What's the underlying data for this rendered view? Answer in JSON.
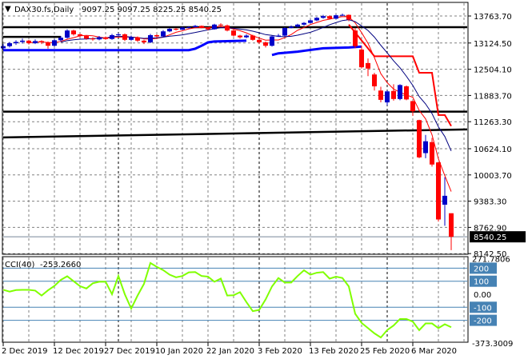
{
  "colors": {
    "bull": "#0000c8",
    "bear": "#ff0000",
    "cci": "#80ff00",
    "level": "#4682b4",
    "grid": "#808080",
    "support": "#0000ff",
    "ma_fast": "#ff0000",
    "ma_slow": "#000080"
  },
  "chart_data": [
    {
      "type": "candlestick",
      "title": "DAX30.fs,Daily",
      "ohlc_text": "9097.25 9097.25 8225.25 8540.25",
      "ylim": [
        8142.5,
        13763.7
      ],
      "y_ticks": [
        "13763.70",
        "13124.50",
        "12504.10",
        "11883.70",
        "11263.30",
        "10624.10",
        "10003.70",
        "9383.30",
        "8762.90",
        "8142.50"
      ],
      "y_tick_values": [
        13763.7,
        13124.5,
        12504.1,
        11883.7,
        11263.3,
        10624.1,
        10003.7,
        9383.3,
        8762.9,
        8142.5
      ],
      "current_price": 8540.25,
      "current_price_label": "8540.25",
      "x_labels": [
        {
          "bar": 0,
          "label": "2 Dec 2019"
        },
        {
          "bar": 8,
          "label": "12 Dec 2019"
        },
        {
          "bar": 16,
          "label": "27 Dec 2019"
        },
        {
          "bar": 24,
          "label": "10 Jan 2020"
        },
        {
          "bar": 32,
          "label": "22 Jan 2020"
        },
        {
          "bar": 40,
          "label": "3 Feb 2020"
        },
        {
          "bar": 48,
          "label": "13 Feb 2020"
        },
        {
          "bar": 56,
          "label": "25 Feb 2020"
        },
        {
          "bar": 64,
          "label": "6 Mar 2020"
        }
      ],
      "period_separators": [
        18,
        40,
        60
      ],
      "ohlc": [
        [
          13000,
          13100,
          12960,
          13050
        ],
        [
          13050,
          13150,
          13020,
          13120
        ],
        [
          13120,
          13190,
          13080,
          13150
        ],
        [
          13150,
          13230,
          13110,
          13180
        ],
        [
          13180,
          13200,
          13090,
          13120
        ],
        [
          13120,
          13210,
          13100,
          13170
        ],
        [
          13170,
          13190,
          13100,
          13140
        ],
        [
          13140,
          13160,
          12990,
          13060
        ],
        [
          13060,
          13220,
          13040,
          13190
        ],
        [
          13190,
          13290,
          13160,
          13250
        ],
        [
          13250,
          13450,
          13230,
          13420
        ],
        [
          13420,
          13440,
          13300,
          13330
        ],
        [
          13330,
          13350,
          13260,
          13290
        ],
        [
          13290,
          13310,
          13200,
          13230
        ],
        [
          13230,
          13260,
          13180,
          13210
        ],
        [
          13210,
          13290,
          13190,
          13260
        ],
        [
          13260,
          13280,
          13200,
          13220
        ],
        [
          13220,
          13340,
          13200,
          13310
        ],
        [
          13310,
          13360,
          13300,
          13330
        ],
        [
          13330,
          13350,
          13170,
          13200
        ],
        [
          13200,
          13300,
          13180,
          13260
        ],
        [
          13260,
          13280,
          13150,
          13180
        ],
        [
          13180,
          13200,
          13100,
          13140
        ],
        [
          13140,
          13340,
          13120,
          13310
        ],
        [
          13310,
          13330,
          13250,
          13280
        ],
        [
          13280,
          13430,
          13260,
          13400
        ],
        [
          13400,
          13480,
          13380,
          13460
        ],
        [
          13460,
          13480,
          13420,
          13440
        ],
        [
          13440,
          13510,
          13430,
          13490
        ],
        [
          13490,
          13520,
          13470,
          13500
        ],
        [
          13500,
          13550,
          13490,
          13530
        ],
        [
          13530,
          13540,
          13470,
          13490
        ],
        [
          13490,
          13500,
          13420,
          13450
        ],
        [
          13450,
          13580,
          13440,
          13560
        ],
        [
          13560,
          13590,
          13520,
          13540
        ],
        [
          13540,
          13560,
          13400,
          13420
        ],
        [
          13420,
          13440,
          13280,
          13300
        ],
        [
          13300,
          13320,
          13230,
          13260
        ],
        [
          13260,
          13330,
          13240,
          13300
        ],
        [
          13300,
          13320,
          13180,
          13200
        ],
        [
          13200,
          13220,
          13100,
          13140
        ],
        [
          13140,
          13160,
          13020,
          13060
        ],
        [
          13060,
          13300,
          13040,
          13280
        ],
        [
          13280,
          13340,
          13270,
          13300
        ],
        [
          13300,
          13500,
          13280,
          13480
        ],
        [
          13480,
          13540,
          13470,
          13510
        ],
        [
          13510,
          13580,
          13490,
          13560
        ],
        [
          13560,
          13620,
          13540,
          13600
        ],
        [
          13600,
          13680,
          13590,
          13660
        ],
        [
          13660,
          13740,
          13640,
          13720
        ],
        [
          13720,
          13790,
          13700,
          13760
        ],
        [
          13760,
          13780,
          13690,
          13700
        ],
        [
          13700,
          13800,
          13690,
          13780
        ],
        [
          13780,
          13820,
          13760,
          13790
        ],
        [
          13790,
          13800,
          13640,
          13680
        ],
        [
          13420,
          13480,
          13000,
          13050
        ],
        [
          12970,
          13060,
          12520,
          12550
        ],
        [
          12650,
          12760,
          12340,
          12520
        ],
        [
          12380,
          12420,
          12000,
          12100
        ],
        [
          12000,
          12090,
          11720,
          11780
        ],
        [
          11720,
          12000,
          11650,
          11980
        ],
        [
          11990,
          12150,
          11760,
          11800
        ],
        [
          11800,
          12150,
          11770,
          12130
        ],
        [
          12100,
          12120,
          11770,
          11790
        ],
        [
          11750,
          11760,
          11400,
          11510
        ],
        [
          11300,
          11310,
          10400,
          10420
        ],
        [
          10520,
          10950,
          10400,
          10800
        ],
        [
          10780,
          10880,
          10200,
          10250
        ],
        [
          10300,
          10310,
          8900,
          8950
        ],
        [
          9300,
          9950,
          8800,
          9510
        ],
        [
          9097.25,
          9097.25,
          8225.25,
          8540.25
        ]
      ],
      "horizontal_levels": [
        13500,
        11500
      ],
      "trendlines": [
        {
          "from": [
            0,
            10890
          ],
          "to": [
            70,
            11080
          ]
        },
        {
          "from": [
            0,
            13270
          ],
          "to": [
            9,
            13270
          ]
        }
      ],
      "support_lines": [
        [
          [
            0,
            12955
          ],
          [
            29,
            12955
          ],
          [
            30,
            12990
          ],
          [
            31,
            13060
          ],
          [
            32,
            13140
          ],
          [
            33,
            13160
          ],
          [
            38,
            13180
          ]
        ],
        [
          [
            42,
            12840
          ],
          [
            43,
            12880
          ],
          [
            46,
            12920
          ],
          [
            50,
            13000
          ],
          [
            54,
            13020
          ],
          [
            56,
            13040
          ]
        ]
      ],
      "step_line": [
        [
          54,
          13560
        ],
        [
          58,
          12810
        ],
        [
          64,
          12810
        ],
        [
          65,
          12420
        ],
        [
          67,
          12420
        ],
        [
          68,
          11420
        ],
        [
          69,
          11420
        ],
        [
          70,
          11160
        ]
      ],
      "ma_periods": [
        5,
        10
      ]
    },
    {
      "type": "line",
      "title": "CCI(40)",
      "value_text": "-253.2660",
      "ylim": [
        -373.3009,
        271.7806
      ],
      "top_label": "271.7806",
      "bottom_label": "-373.3009",
      "levels": [
        {
          "value": 200,
          "label": "200",
          "boxed": true
        },
        {
          "value": 100,
          "label": "100",
          "boxed": true
        },
        {
          "value": 0,
          "label": "0.00",
          "boxed": false
        },
        {
          "value": -100,
          "label": "-100",
          "boxed": true
        },
        {
          "value": -200,
          "label": "-200",
          "boxed": true
        }
      ],
      "values": [
        34,
        20,
        32,
        34,
        34,
        28,
        -10,
        30,
        64,
        110,
        138,
        100,
        62,
        44,
        84,
        96,
        96,
        0,
        140,
        0,
        -110,
        -10,
        80,
        240,
        210,
        185,
        150,
        130,
        140,
        168,
        170,
        140,
        135,
        96,
        120,
        -10,
        -8,
        16,
        -60,
        -130,
        -120,
        -40,
        60,
        124,
        90,
        90,
        140,
        184,
        150,
        165,
        170,
        120,
        135,
        125,
        60,
        -150,
        -220,
        -260,
        -300,
        -332,
        -275,
        -240,
        -190,
        -190,
        -210,
        -276,
        -224,
        -224,
        -260,
        -230,
        -253.266
      ]
    }
  ]
}
